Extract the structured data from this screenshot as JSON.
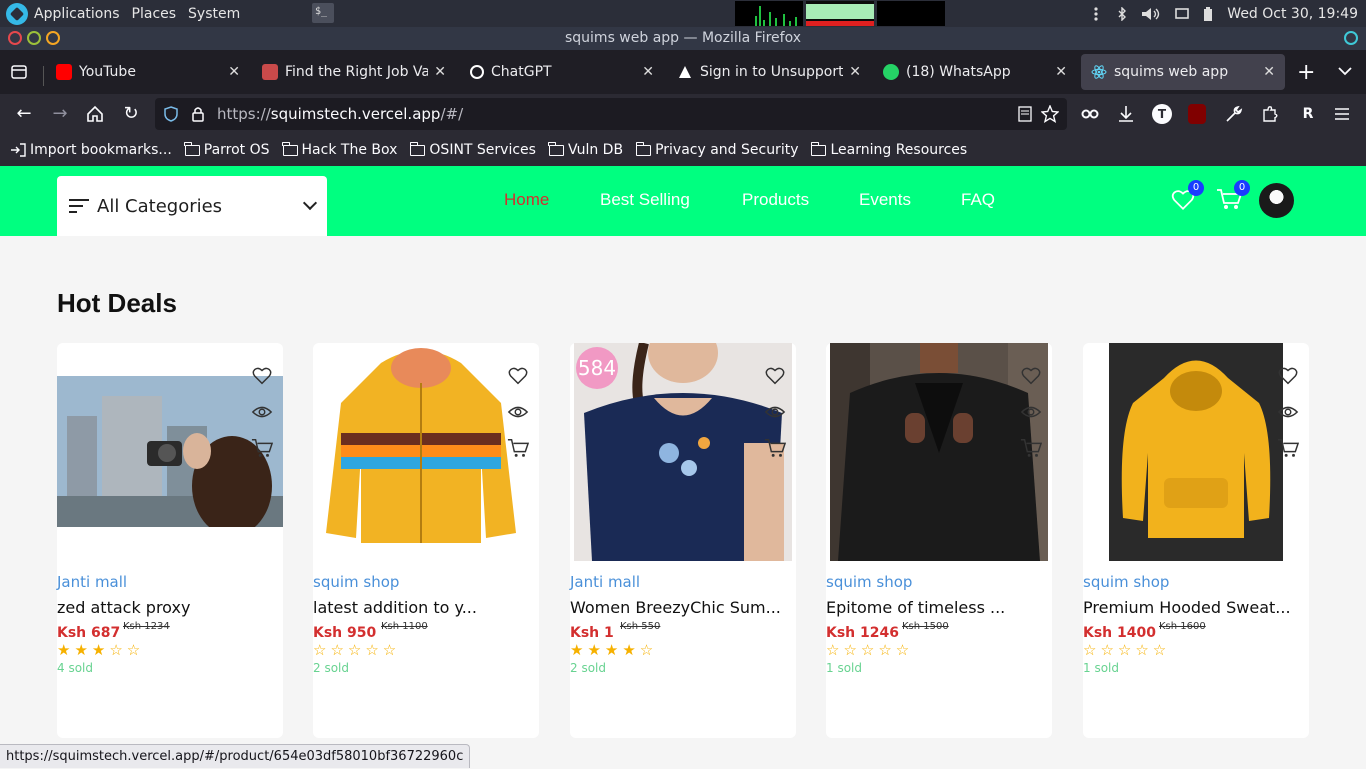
{
  "system": {
    "menus": [
      "Applications",
      "Places",
      "System"
    ],
    "clock": "Wed Oct 30, 19:49",
    "terminal_glyph": "$_"
  },
  "window": {
    "title": "squims web app — Mozilla Firefox"
  },
  "tabs": [
    {
      "label": "YouTube",
      "icon": "youtube-icon",
      "color": "#ff0000"
    },
    {
      "label": "Find the Right Job Vaca",
      "icon": "job-icon",
      "color": "#c94a4a"
    },
    {
      "label": "ChatGPT",
      "icon": "chatgpt-icon",
      "color": "#ffffff"
    },
    {
      "label": "Sign in to Unsupported",
      "icon": "triangle-icon",
      "color": "#ffffff"
    },
    {
      "label": "(18) WhatsApp",
      "icon": "whatsapp-icon",
      "color": "#25d366"
    },
    {
      "label": "squims web app",
      "icon": "react-icon",
      "color": "#61dafb"
    }
  ],
  "navigation": {
    "url_prefix": "https://",
    "url_host": "squimstech.vercel.app",
    "url_path": "/#/"
  },
  "bookmarks": [
    "Import bookmarks...",
    "Parrot OS",
    "Hack The Box",
    "OSINT Services",
    "Vuln DB",
    "Privacy and Security",
    "Learning Resources"
  ],
  "header": {
    "categories_label": "All Categories",
    "nav": [
      "Home",
      "Best Selling",
      "Products",
      "Events",
      "FAQ"
    ],
    "wishlist_count": "0",
    "cart_count": "0",
    "accent": "#00ff80",
    "active_color": "#d32f2f"
  },
  "section_title": "Hot Deals",
  "products": [
    {
      "shop": "Janti mall",
      "name": "zed attack proxy",
      "price": "Ksh 687",
      "old_price": "Ksh 1234",
      "rating": 3,
      "stars": "★★★☆☆",
      "sold": "4 sold"
    },
    {
      "shop": "squim shop",
      "name": "latest addition to y...",
      "price": "Ksh 950",
      "old_price": "Ksh 1100",
      "rating": 0,
      "stars": "☆☆☆☆☆",
      "sold": "2 sold"
    },
    {
      "shop": "Janti mall",
      "name": "Women BreezyChic Sum...",
      "price": "Ksh 1",
      "old_price": "Ksh 550",
      "rating": 4,
      "stars": "★★★★☆",
      "sold": "2 sold",
      "badge": "584"
    },
    {
      "shop": "squim shop",
      "name": "Epitome of timeless ...",
      "price": "Ksh 1246",
      "old_price": "Ksh 1500",
      "rating": 0,
      "stars": "☆☆☆☆☆",
      "sold": "1 sold"
    },
    {
      "shop": "squim shop",
      "name": "Premium Hooded Sweat...",
      "price": "Ksh 1400",
      "old_price": "Ksh 1600",
      "rating": 0,
      "stars": "☆☆☆☆☆",
      "sold": "1 sold"
    }
  ],
  "status_url": "https://squimstech.vercel.app/#/product/654e03df58010bf36722960c"
}
